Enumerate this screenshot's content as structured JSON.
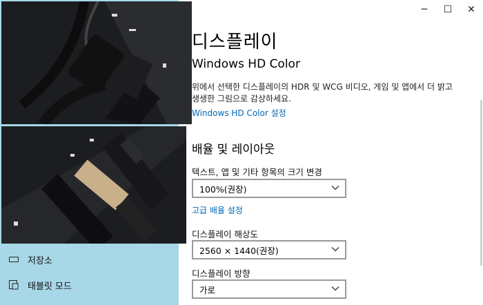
{
  "window": {
    "minimize_glyph": "─",
    "maximize_glyph": "☐",
    "close_glyph": "✕"
  },
  "page": {
    "title": "디스플레이",
    "hdr_section": {
      "title": "Windows HD Color",
      "description": "위에서 선택한 디스플레이의 HDR 및 WCG 비디오, 게임 및 앱에서 더 밝고 생생한 그림으로 감상하세요.",
      "settings_link": "Windows HD Color 설정"
    },
    "layout_section": {
      "title": "배율 및 레이아웃",
      "scale_label": "텍스트, 앱 및 기타 항목의 크기 변경",
      "scale_value": "100%(권장)",
      "advanced_scale_link": "고급 배율 설정",
      "resolution_label": "디스플레이 해상도",
      "resolution_value": "2560 × 1440(권장)",
      "orientation_label": "디스플레이 방향",
      "orientation_value": "가로"
    }
  },
  "nav": {
    "items": [
      {
        "label": "저장소",
        "icon": "storage-icon"
      },
      {
        "label": "태블릿 모드",
        "icon": "tablet-mode-icon"
      }
    ]
  },
  "colors": {
    "accent": "#0067b8",
    "nav_bg": "#a8d8e8"
  }
}
